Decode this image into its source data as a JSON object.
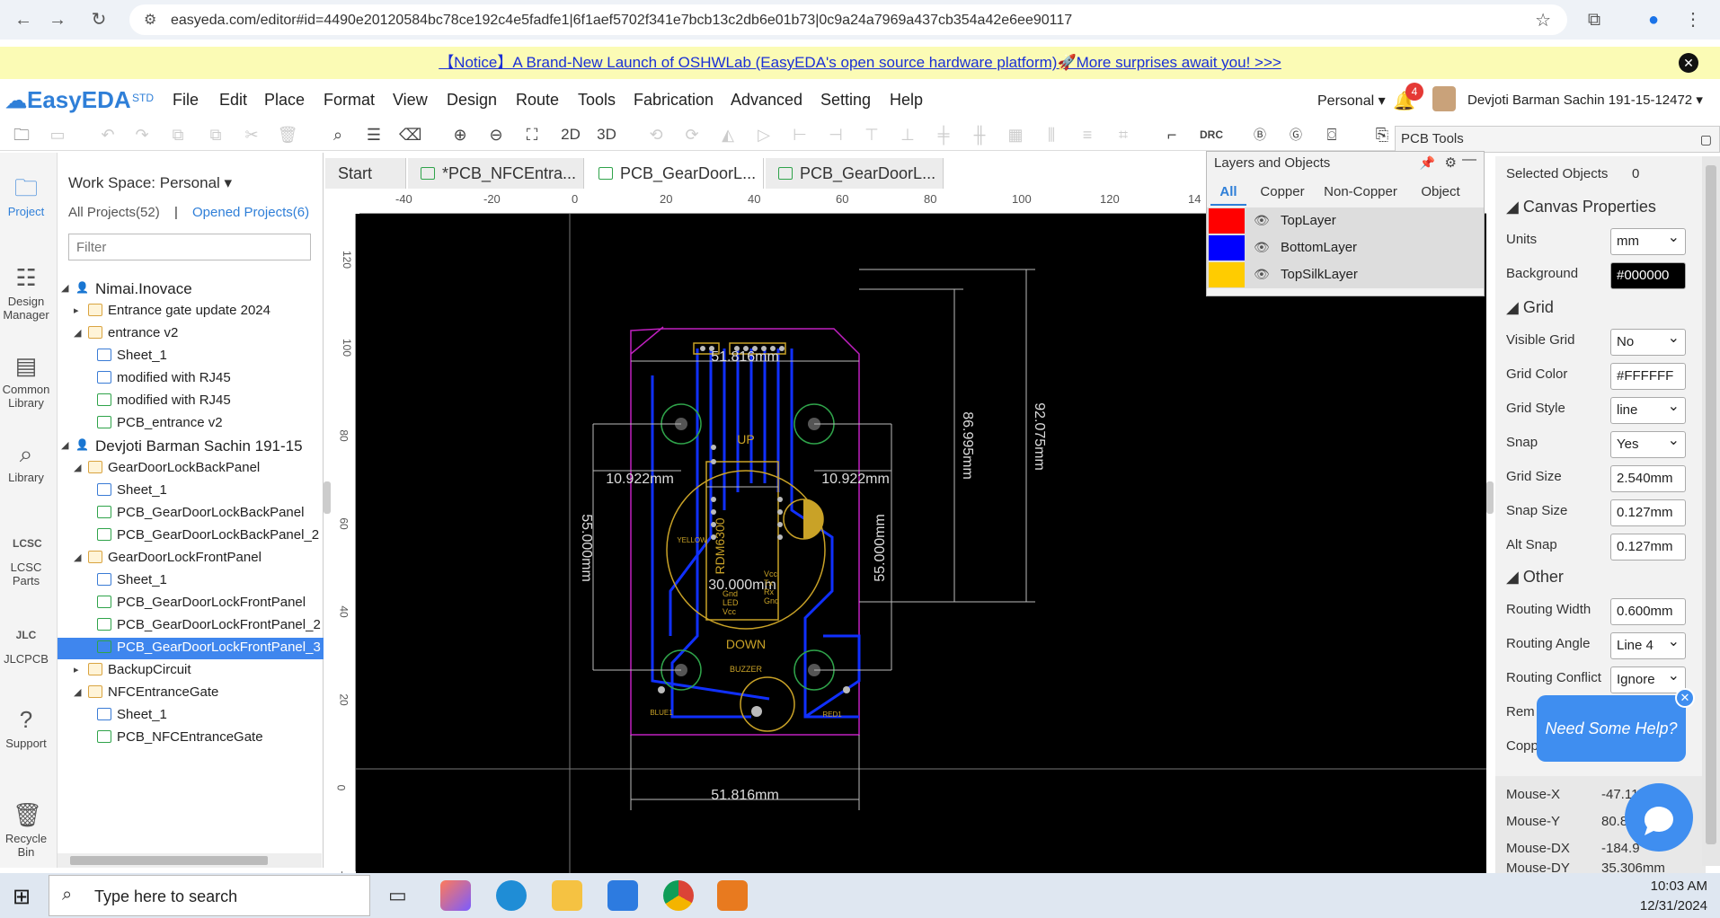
{
  "browser": {
    "url": "easyeda.com/editor#id=4490e20120584bc78ce192c4e5fadfe1|6f1aef5702f341e7bcb13c2db6e01b73|0c9a24a7969a437cb354a42e6ee90117",
    "notification_count": "4"
  },
  "notice": {
    "text": "【Notice】A Brand-New Launch of OSHWLab (EasyEDA's open source hardware platform)🚀More surprises await you! >>>"
  },
  "app": {
    "logo": "EasyEDA",
    "logo_sup": "STD",
    "menu": [
      "File",
      "Edit",
      "Place",
      "Format",
      "View",
      "Design",
      "Route",
      "Tools",
      "Fabrication",
      "Advanced",
      "Setting",
      "Help"
    ],
    "workspace_dropdown": "Personal",
    "user_name": "Devjoti Barman Sachin 191-15-12472"
  },
  "toolbar": {
    "btn_2d": "2D",
    "btn_3d": "3D",
    "btn_drc": "DRC"
  },
  "left_rail": {
    "items": [
      "Project",
      "Design Manager",
      "Common Library",
      "Library",
      "LCSC Parts",
      "JLCPCB",
      "Support",
      "Recycle Bin"
    ]
  },
  "project_panel": {
    "workspace": "Work Space: Personal",
    "all_projects": "All Projects(52)",
    "separator": "|",
    "opened_projects": "Opened Projects(6)",
    "filter_placeholder": "Filter",
    "tree": [
      {
        "label": "Nimai.Inovace",
        "type": "user",
        "level": 0,
        "toggle": "◢"
      },
      {
        "label": "Entrance gate update 2024",
        "type": "folder",
        "level": 1,
        "toggle": "▸"
      },
      {
        "label": "entrance v2",
        "type": "folder",
        "level": 1,
        "toggle": "◢"
      },
      {
        "label": "Sheet_1",
        "type": "sheet",
        "level": 2,
        "toggle": ""
      },
      {
        "label": "modified with RJ45",
        "type": "sheet",
        "level": 2,
        "toggle": ""
      },
      {
        "label": "modified with RJ45",
        "type": "pcb",
        "level": 2,
        "toggle": ""
      },
      {
        "label": "PCB_entrance v2",
        "type": "pcb",
        "level": 2,
        "toggle": ""
      },
      {
        "label": "Devjoti Barman Sachin 191-15",
        "type": "user",
        "level": 0,
        "toggle": "◢"
      },
      {
        "label": "GearDoorLockBackPanel",
        "type": "folder",
        "level": 1,
        "toggle": "◢"
      },
      {
        "label": "Sheet_1",
        "type": "sheet",
        "level": 2,
        "toggle": ""
      },
      {
        "label": "PCB_GearDoorLockBackPanel",
        "type": "pcb",
        "level": 2,
        "toggle": ""
      },
      {
        "label": "PCB_GearDoorLockBackPanel_2",
        "type": "pcb",
        "level": 2,
        "toggle": ""
      },
      {
        "label": "GearDoorLockFrontPanel",
        "type": "folder",
        "level": 1,
        "toggle": "◢"
      },
      {
        "label": "Sheet_1",
        "type": "sheet",
        "level": 2,
        "toggle": ""
      },
      {
        "label": "PCB_GearDoorLockFrontPanel",
        "type": "pcb",
        "level": 2,
        "toggle": ""
      },
      {
        "label": "PCB_GearDoorLockFrontPanel_2",
        "type": "pcb",
        "level": 2,
        "toggle": ""
      },
      {
        "label": "PCB_GearDoorLockFrontPanel_3",
        "type": "pcb",
        "level": 2,
        "toggle": "",
        "selected": true
      },
      {
        "label": "BackupCircuit",
        "type": "folder",
        "level": 1,
        "toggle": "▸"
      },
      {
        "label": "NFCEntranceGate",
        "type": "folder",
        "level": 1,
        "toggle": "◢"
      },
      {
        "label": "Sheet_1",
        "type": "sheet",
        "level": 2,
        "toggle": ""
      },
      {
        "label": "PCB_NFCEntranceGate",
        "type": "pcb",
        "level": 2,
        "toggle": ""
      }
    ]
  },
  "doc_tabs": [
    "Start",
    "*PCB_NFCEntra...",
    "PCB_GearDoorL...",
    "PCB_GearDoorL..."
  ],
  "ruler": {
    "h_labels": [
      "-40",
      "-20",
      "0",
      "20",
      "40",
      "60",
      "80",
      "100",
      "120",
      "14"
    ],
    "v_labels": [
      "120",
      "100",
      "80",
      "60",
      "40",
      "20",
      "0",
      "-2"
    ]
  },
  "pcb": {
    "dims": {
      "top_width": "51.816mm",
      "bottom_width": "51.816mm",
      "left_span": "10.922mm",
      "right_span": "10.922mm",
      "left_height": "55.000mm",
      "right_height": "55.000mm",
      "center_width": "30.000mm",
      "inner_height": "86.995mm",
      "outer_height": "92.075mm"
    },
    "silk": {
      "up": "UP",
      "down": "DOWN",
      "module": "RDM6300",
      "buzzer": "BUZZER",
      "blue": "BLUE1",
      "red": "RED1",
      "yellow": "YELLOW",
      "pins": [
        "Vcc",
        "Tx",
        "Rx",
        "Gnd",
        "LED",
        "Vcc",
        "Gnd"
      ]
    }
  },
  "layers": {
    "title": "Layers and Objects",
    "tabs": [
      "All",
      "Copper",
      "Non-Copper",
      "Object"
    ],
    "items": [
      {
        "name": "TopLayer",
        "color": "#ff0000"
      },
      {
        "name": "BottomLayer",
        "color": "#0000ff"
      },
      {
        "name": "TopSilkLayer",
        "color": "#ffcc00"
      }
    ]
  },
  "pcb_tools": {
    "title": "PCB Tools"
  },
  "properties": {
    "selected_label": "Selected Objects",
    "selected_count": "0",
    "canvas_section": "Canvas Properties",
    "units_label": "Units",
    "units_value": "mm",
    "background_label": "Background",
    "background_value": "#000000",
    "grid_section": "Grid",
    "visible_grid_label": "Visible Grid",
    "visible_grid_value": "No",
    "grid_color_label": "Grid Color",
    "grid_color_value": "#FFFFFF",
    "grid_style_label": "Grid Style",
    "grid_style_value": "line",
    "snap_label": "Snap",
    "snap_value": "Yes",
    "grid_size_label": "Grid Size",
    "grid_size_value": "2.540mm",
    "snap_size_label": "Snap Size",
    "snap_size_value": "0.127mm",
    "alt_snap_label": "Alt Snap",
    "alt_snap_value": "0.127mm",
    "other_section": "Other",
    "routing_width_label": "Routing Width",
    "routing_width_value": "0.600mm",
    "routing_angle_label": "Routing Angle",
    "routing_angle_value": "Line 4",
    "routing_conflict_label": "Routing Conflict",
    "routing_conflict_value": "Ignore",
    "rem_label": "Rem",
    "copp_label": "Copp",
    "mouse_x_label": "Mouse-X",
    "mouse_x_value": "-47.117",
    "mouse_y_label": "Mouse-Y",
    "mouse_y_value": "80.8",
    "mouse_dx_label": "Mouse-DX",
    "mouse_dx_value": "-184.9",
    "mouse_dy_label": "Mouse-DY",
    "mouse_dy_value": "35.306mm"
  },
  "help": {
    "text": "Need Some Help?"
  },
  "taskbar": {
    "search_placeholder": "Type here to search",
    "time": "10:03 AM",
    "date": "12/31/2024"
  }
}
